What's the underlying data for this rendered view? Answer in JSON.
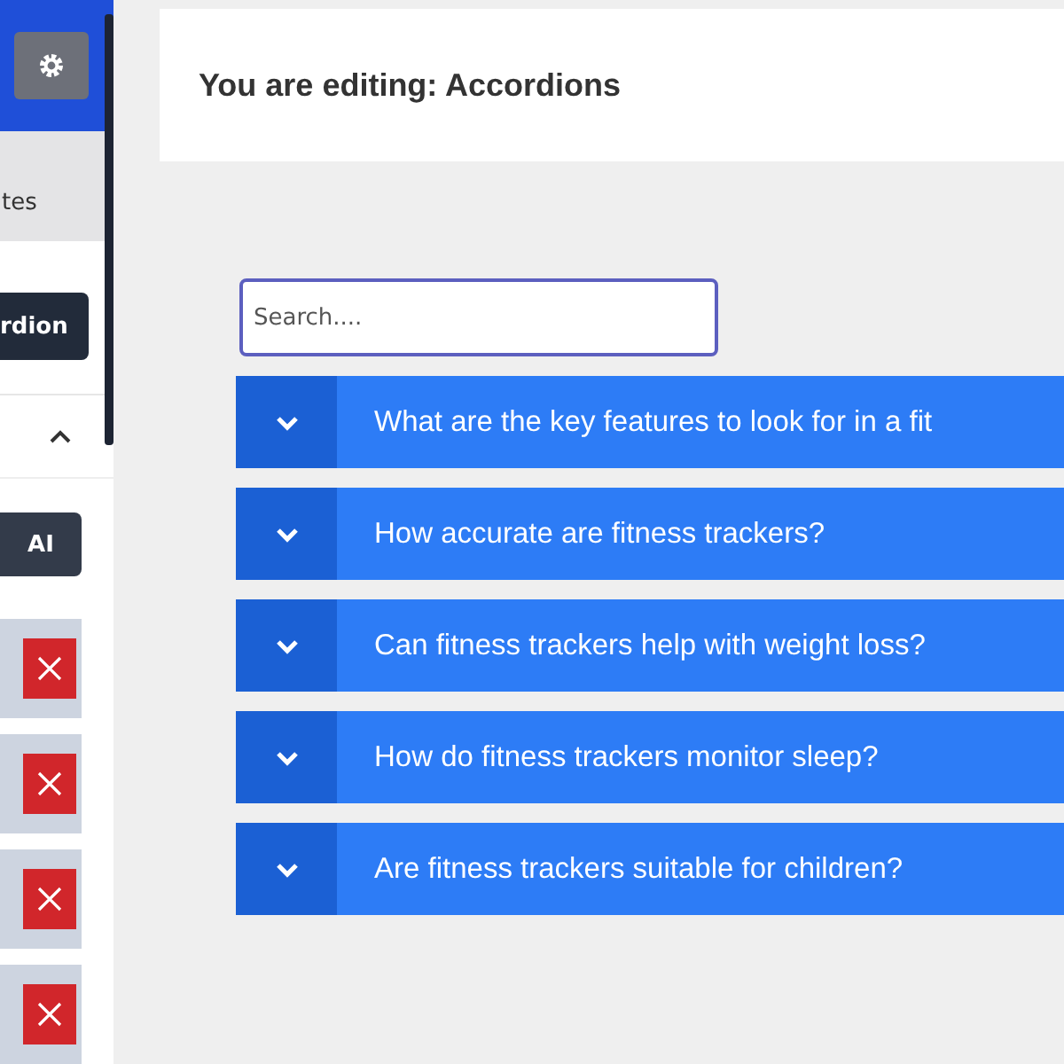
{
  "sidebar": {
    "header_label": "tes",
    "primary_button": "rdion",
    "section_expanded": true,
    "ai_button": "AI",
    "rows": [
      {
        "kind": "item"
      },
      {
        "kind": "item"
      },
      {
        "kind": "item"
      },
      {
        "kind": "item"
      }
    ]
  },
  "header": {
    "title": "You are editing: Accordions"
  },
  "search": {
    "placeholder": "Search...."
  },
  "accordion": [
    {
      "question": "What are the key features to look for in a fit",
      "expanded": false
    },
    {
      "question": "How accurate are fitness trackers?",
      "expanded": false
    },
    {
      "question": "Can fitness trackers help with weight loss?",
      "expanded": false
    },
    {
      "question": "How do fitness trackers monitor sleep?",
      "expanded": false
    },
    {
      "question": "Are fitness trackers suitable for children?",
      "expanded": false
    }
  ]
}
